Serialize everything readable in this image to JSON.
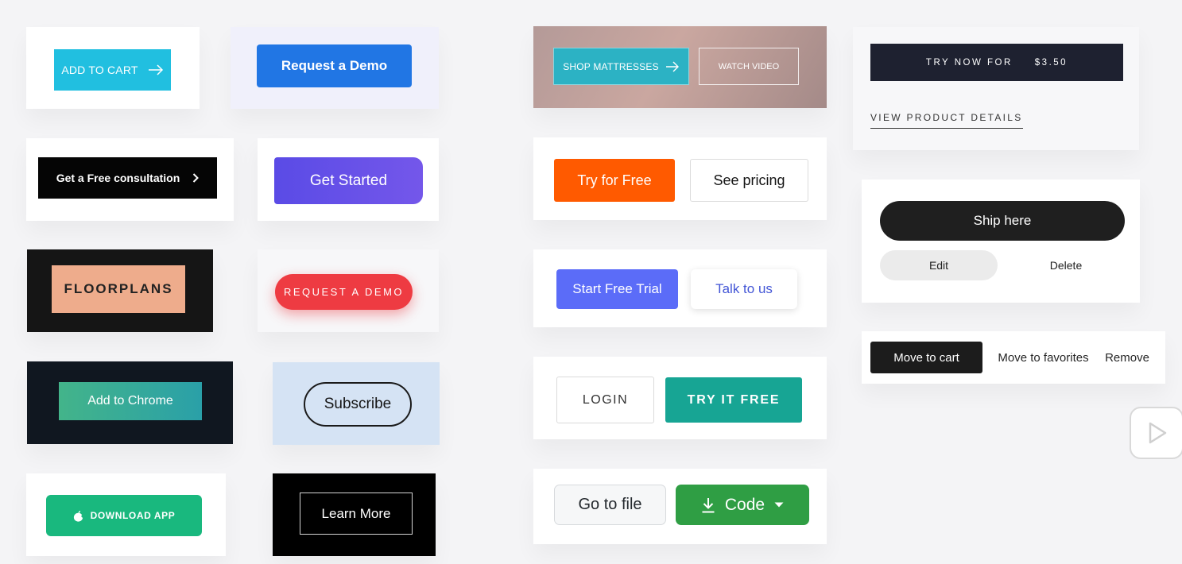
{
  "buttons": {
    "add_to_cart": "ADD TO CART",
    "request_demo_blue": "Request a Demo",
    "free_consultation": "Get a Free consultation",
    "get_started": "Get Started",
    "floorplans": "FLOORPLANS",
    "request_demo_red": "REQUEST A DEMO",
    "add_to_chrome": "Add to Chrome",
    "subscribe": "Subscribe",
    "download_app": "DOWNLOAD APP",
    "learn_more": "Learn More",
    "shop_mattresses": "SHOP MATTRESSES",
    "watch_video": "WATCH VIDEO",
    "try_for_free": "Try for Free",
    "see_pricing": "See pricing",
    "start_free_trial": "Start Free Trial",
    "talk_to_us": "Talk to us",
    "login": "LOGIN",
    "try_it_free": "TRY IT FREE",
    "go_to_file": "Go to file",
    "code": "Code",
    "try_now_for": "TRY NOW FOR",
    "try_now_price": "$3.50",
    "view_product_details": "VIEW PRODUCT DETAILS",
    "ship_here": "Ship here",
    "edit": "Edit",
    "delete": "Delete",
    "move_to_cart": "Move to cart",
    "move_to_favorites": "Move to favorites",
    "remove": "Remove"
  },
  "icons": {
    "add_to_cart": "arrow-right-icon",
    "free_consultation": "chevron-right-icon",
    "download_app": "apple-icon",
    "shop_mattresses": "arrow-right-icon",
    "code_download": "download-icon",
    "code_caret": "caret-down-icon",
    "video_overlay": "play-icon"
  },
  "colors": {
    "add_to_cart": "#21bfe0",
    "request_demo_blue": "#2176e4",
    "get_started": "#5a4be6",
    "floorplans": "#eeac8c",
    "request_demo_red": "#ee3b42",
    "download_app": "#19b87e",
    "try_for_free": "#ff5a00",
    "start_free_trial": "#5b6cf8",
    "try_it_free": "#17a594",
    "code": "#2f9e44"
  }
}
